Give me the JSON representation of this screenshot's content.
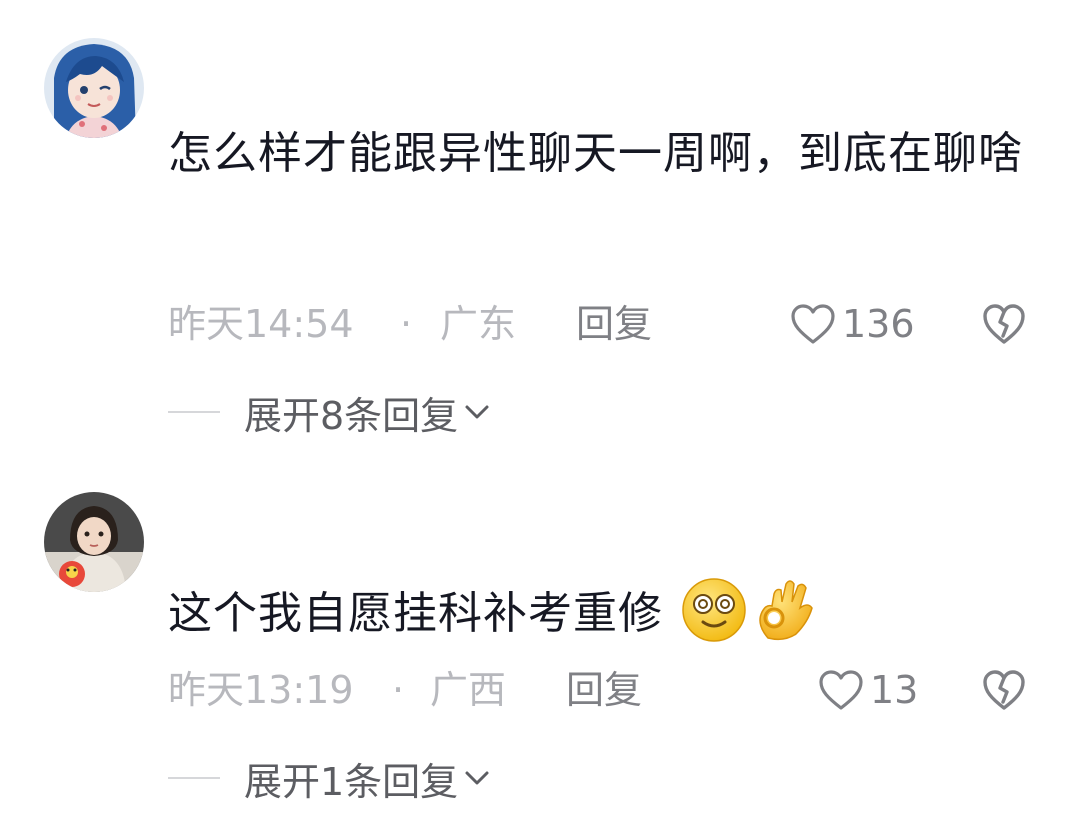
{
  "comments": [
    {
      "avatar_icon": "anime-girl-avatar",
      "text": "怎么样才能跟异性聊天一周啊，到底在聊啥",
      "time": "昨天14:54",
      "dot": "·",
      "location": "广东",
      "reply_label": "回复",
      "likes": "136",
      "expand_label": "展开8条回复",
      "emojis": []
    },
    {
      "avatar_icon": "child-photo-avatar",
      "text": "这个我自愿挂科补考重修",
      "time": "昨天13:19",
      "dot": "·",
      "location": "广西",
      "reply_label": "回复",
      "likes": "13",
      "expand_label": "展开1条回复",
      "emojis": [
        "dizzy-face-emoji",
        "ok-hand-emoji"
      ]
    }
  ],
  "colors": {
    "text_primary": "#161823",
    "meta_light": "#b7b8bd",
    "meta_dark": "#7f8085",
    "expand_text": "#5c5d62",
    "emoji_yellow": "#f7c21b"
  }
}
